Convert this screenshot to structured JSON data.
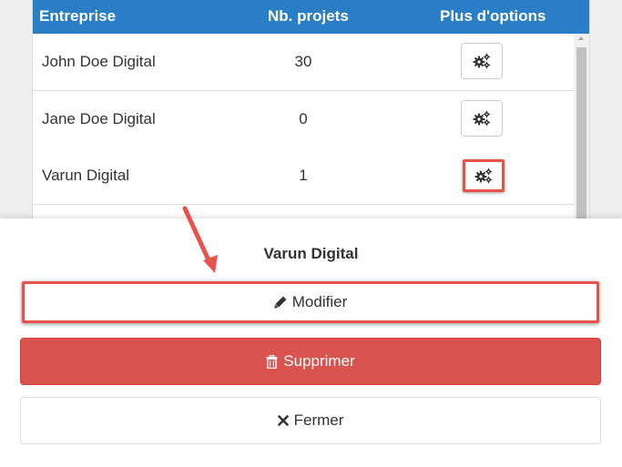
{
  "table": {
    "headers": [
      "Entreprise",
      "Nb. projets",
      "Plus d'options"
    ],
    "rows": [
      {
        "name": "John Doe Digital",
        "count": "30"
      },
      {
        "name": "Jane Doe Digital",
        "count": "0"
      },
      {
        "name": "Varun Digital",
        "count": "1"
      }
    ],
    "header_color": "#2a7ec5"
  },
  "sheet": {
    "title": "Varun Digital",
    "modify_label": "Modifier",
    "delete_label": "Supprimer",
    "close_label": "Fermer"
  },
  "colors": {
    "highlight": "#e8524a",
    "danger": "#d9534f"
  },
  "icons": [
    "gears-icon",
    "pencil-icon",
    "trash-icon",
    "times-icon",
    "annotation-arrow-icon"
  ]
}
